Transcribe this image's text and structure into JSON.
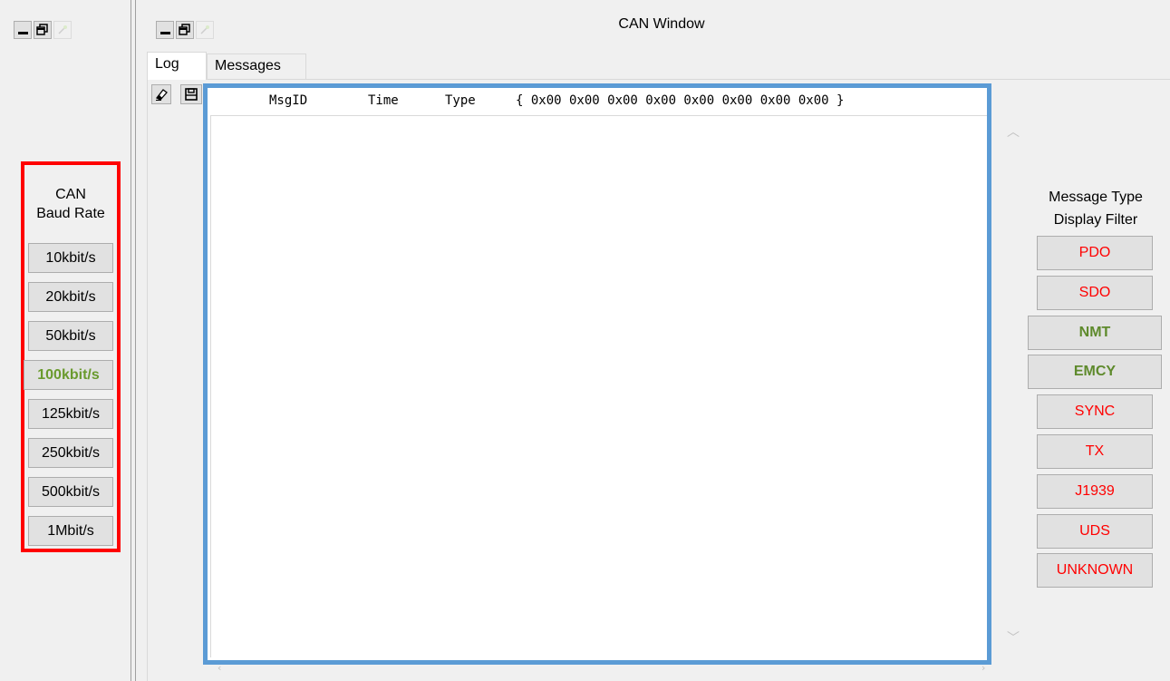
{
  "window": {
    "title": "CAN Window"
  },
  "tabs": [
    {
      "label": "Log",
      "active": true
    },
    {
      "label": "Messages",
      "active": false
    }
  ],
  "baud": {
    "title_line1": "CAN",
    "title_line2": "Baud Rate",
    "options": [
      {
        "label": "10kbit/s",
        "selected": false
      },
      {
        "label": "20kbit/s",
        "selected": false
      },
      {
        "label": "50kbit/s",
        "selected": false
      },
      {
        "label": "100kbit/s",
        "selected": true
      },
      {
        "label": "125kbit/s",
        "selected": false
      },
      {
        "label": "250kbit/s",
        "selected": false
      },
      {
        "label": "500kbit/s",
        "selected": false
      },
      {
        "label": "1Mbit/s",
        "selected": false
      }
    ],
    "highlight_color": "#ff0000",
    "selected_color": "#6a9a2e"
  },
  "log": {
    "columns": {
      "msgid": "MsgID",
      "time": "Time",
      "type": "Type",
      "data": "{ 0x00 0x00 0x00 0x00 0x00 0x00 0x00 0x00 }"
    },
    "toolbar": {
      "clear_icon": "eraser-icon",
      "save_icon": "save-icon"
    },
    "highlight_color": "#5b9bd5"
  },
  "filter": {
    "title_line1": "Message Type",
    "title_line2": "Display Filter",
    "items": [
      {
        "label": "PDO",
        "enabled": false
      },
      {
        "label": "SDO",
        "enabled": false
      },
      {
        "label": "NMT",
        "enabled": true
      },
      {
        "label": "EMCY",
        "enabled": true
      },
      {
        "label": "SYNC",
        "enabled": false
      },
      {
        "label": "TX",
        "enabled": false
      },
      {
        "label": "J1939",
        "enabled": false
      },
      {
        "label": "UDS",
        "enabled": false
      },
      {
        "label": "UNKNOWN",
        "enabled": false
      }
    ],
    "off_color": "#ff0000",
    "on_color": "#5e8a2c"
  }
}
